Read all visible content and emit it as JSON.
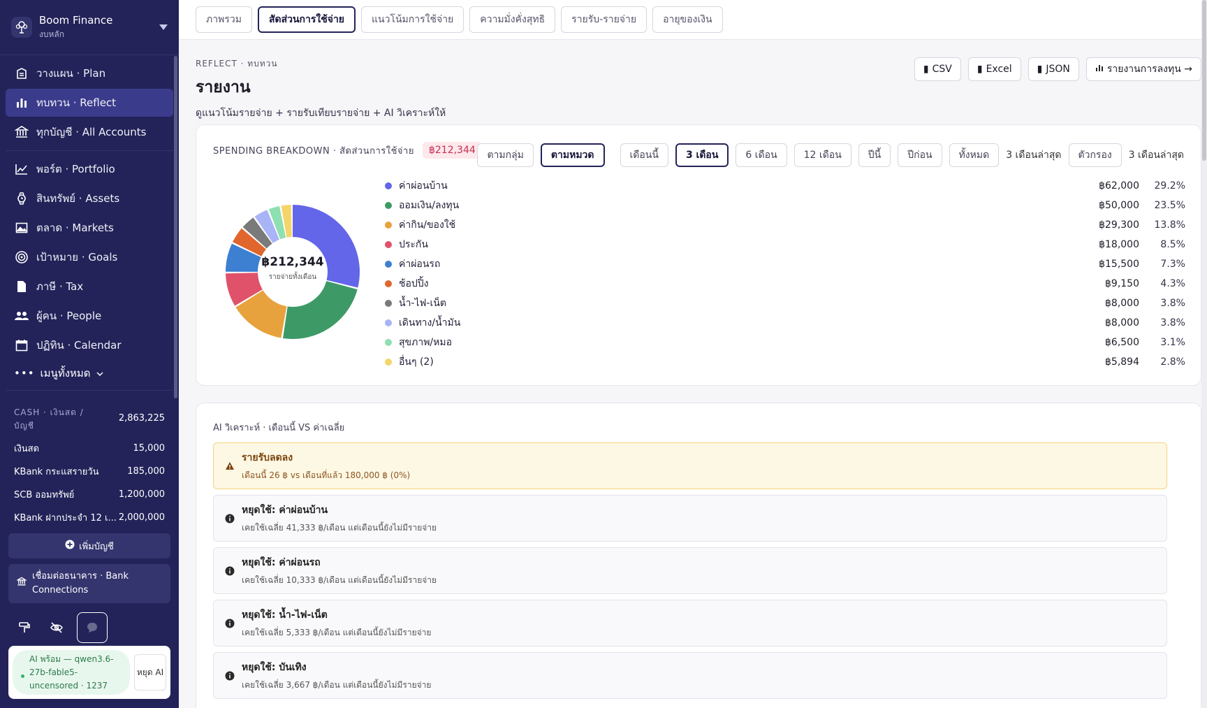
{
  "brand": {
    "name": "Boom Finance",
    "sub": "งบหลัก"
  },
  "nav": {
    "items": [
      {
        "label": "วางแผน · Plan",
        "icon": "plan-icon"
      },
      {
        "label": "ทบทวน · Reflect",
        "icon": "bar-chart-icon",
        "active": true
      },
      {
        "label": "ทุกบัญชี · All Accounts",
        "icon": "bank-icon"
      },
      {
        "label": "พอร์ต · Portfolio",
        "icon": "line-chart-icon"
      },
      {
        "label": "สินทรัพย์ · Assets",
        "icon": "watch-icon"
      },
      {
        "label": "ตลาด · Markets",
        "icon": "image-icon"
      },
      {
        "label": "เป้าหมาย · Goals",
        "icon": "target-icon"
      },
      {
        "label": "ภาษี · Tax",
        "icon": "document-icon"
      },
      {
        "label": "ผู้คน · People",
        "icon": "people-icon"
      },
      {
        "label": "ปฏิทิน · Calendar",
        "icon": "calendar-icon"
      }
    ],
    "more": "เมนูทั้งหมด"
  },
  "cash": {
    "title": "CASH · เงินสด / บัญชี",
    "total": "2,863,225",
    "rows": [
      {
        "name": "เงินสด",
        "value": "15,000"
      },
      {
        "name": "KBank กระแสรายวัน",
        "value": "185,000"
      },
      {
        "name": "SCB ออมทรัพย์",
        "value": "1,200,000"
      },
      {
        "name": "KBank ฝากประจำ 12 เ...",
        "value": "2,000,000"
      }
    ],
    "add_label": "เพิ่มบัญชี",
    "bank_label": "เชื่อมต่อธนาคาร · Bank Connections"
  },
  "ai_status": {
    "text": "AI พร้อม — qwen3.6-27b-fable5-uncensored · 1237",
    "stop": "หยุด AI"
  },
  "tabs": [
    {
      "label": "ภาพรวม"
    },
    {
      "label": "สัดส่วนการใช้จ่าย",
      "active": true
    },
    {
      "label": "แนวโน้มการใช้จ่าย"
    },
    {
      "label": "ความมั่งคั่งสุทธิ"
    },
    {
      "label": "รายรับ-รายจ่าย"
    },
    {
      "label": "อายุของเงิน"
    }
  ],
  "page": {
    "crumb": "REFLECT · ทบทวน",
    "title": "รายงาน",
    "subtitle": "ดูแนวโน้มรายจ่าย + รายรับเทียบรายจ่าย + AI วิเคราะห์ให้"
  },
  "exports": [
    {
      "label": "CSV"
    },
    {
      "label": "Excel"
    },
    {
      "label": "JSON"
    },
    {
      "label": "รายงานการลงทุน →"
    }
  ],
  "breakdown": {
    "title": "SPENDING BREAKDOWN · สัดส่วนการใช้จ่าย",
    "total_badge": "฿212,344",
    "group_modes": [
      {
        "label": "ตามกลุ่ม"
      },
      {
        "label": "ตามหมวด",
        "active": true
      }
    ],
    "periods": [
      {
        "label": "เดือนนี้"
      },
      {
        "label": "3 เดือน",
        "active": true
      },
      {
        "label": "6 เดือน"
      },
      {
        "label": "12 เดือน"
      },
      {
        "label": "ปีนี้"
      },
      {
        "label": "ปีก่อน"
      },
      {
        "label": "ทั้งหมด"
      }
    ],
    "period_text": "3 เดือนล่าสุด",
    "filter_label": "ตัวกรอง",
    "filter_text": "3 เดือนล่าสุด",
    "center_value": "฿212,344",
    "center_label": "รายจ่ายทั้งเดือน"
  },
  "chart_data": {
    "type": "pie",
    "categories": [
      "ค่าผ่อนบ้าน",
      "ออมเงิน/ลงทุน",
      "ค่ากิน/ของใช้",
      "ประกัน",
      "ค่าผ่อนรถ",
      "ช้อปปิ้ง",
      "น้ำ-ไฟ-เน็ต",
      "เดินทาง/น้ำมัน",
      "สุขภาพ/หมอ",
      "อื่นๆ (2)"
    ],
    "values": [
      62000,
      50000,
      29300,
      18000,
      15500,
      9150,
      8000,
      8000,
      6500,
      5894
    ],
    "amounts": [
      "฿62,000",
      "฿50,000",
      "฿29,300",
      "฿18,000",
      "฿15,500",
      "฿9,150",
      "฿8,000",
      "฿8,000",
      "฿6,500",
      "฿5,894"
    ],
    "percents": [
      "29.2%",
      "23.5%",
      "13.8%",
      "8.5%",
      "7.3%",
      "4.3%",
      "3.8%",
      "3.8%",
      "3.1%",
      "2.8%"
    ],
    "colors": [
      "#6366e8",
      "#3d9a66",
      "#e8a23d",
      "#e0526a",
      "#3d7fd0",
      "#e0662e",
      "#7a7a7a",
      "#a8b4f6",
      "#8ee0b0",
      "#f5d46a"
    ]
  },
  "ai": {
    "title": "AI วิเคราะห์ · เดือนนี้ VS ค่าเฉลี่ย",
    "alerts": [
      {
        "title": "รายรับลดลง",
        "sub": "เดือนนี้ 26 ฿ vs เดือนที่แล้ว 180,000 ฿ (0%)",
        "kind": "warn"
      },
      {
        "title": "หยุดใช้: ค่าผ่อนบ้าน",
        "sub": "เคยใช้เฉลี่ย 41,333 ฿/เดือน แต่เดือนนี้ยังไม่มีรายจ่าย",
        "kind": "info"
      },
      {
        "title": "หยุดใช้: ค่าผ่อนรถ",
        "sub": "เคยใช้เฉลี่ย 10,333 ฿/เดือน แต่เดือนนี้ยังไม่มีรายจ่าย",
        "kind": "info"
      },
      {
        "title": "หยุดใช้: น้ำ-ไฟ-เน็ต",
        "sub": "เคยใช้เฉลี่ย 5,333 ฿/เดือน แต่เดือนนี้ยังไม่มีรายจ่าย",
        "kind": "info"
      },
      {
        "title": "หยุดใช้: บันเทิง",
        "sub": "เคยใช้เฉลี่ย 3,667 ฿/เดือน แต่เดือนนี้ยังไม่มีรายจ่าย",
        "kind": "info"
      }
    ]
  }
}
